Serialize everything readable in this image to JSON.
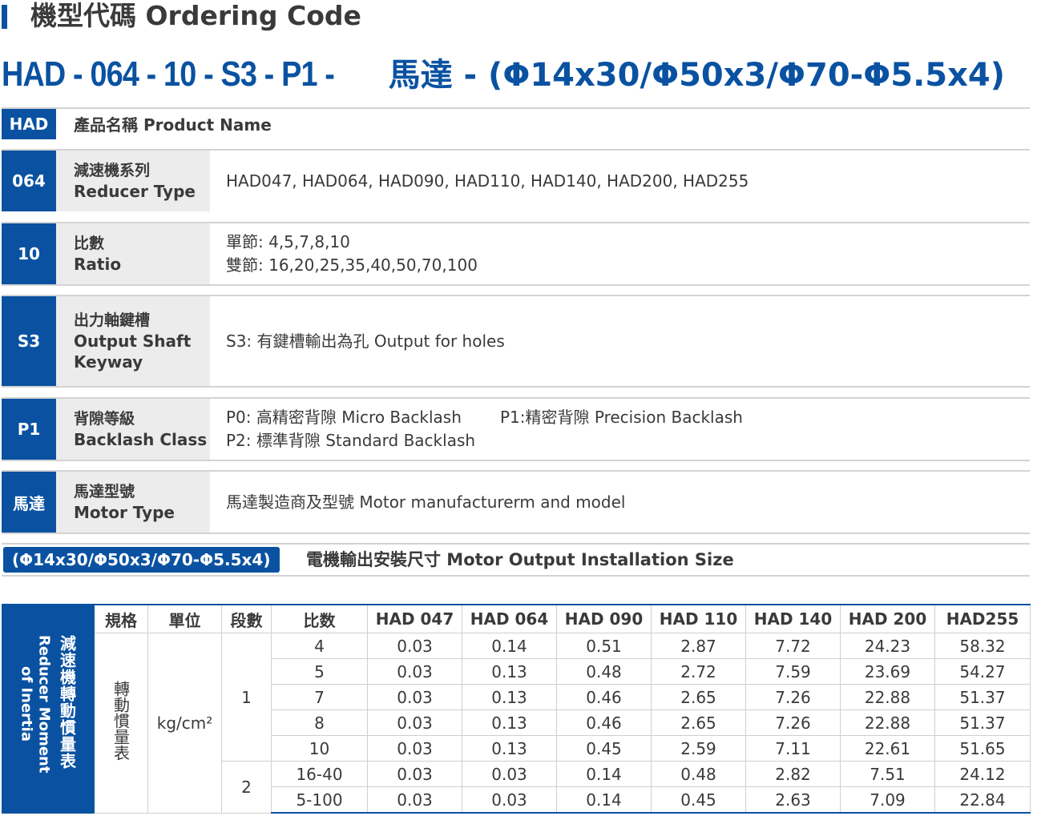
{
  "header": {
    "title": "機型代碼 Ordering Code"
  },
  "code": {
    "part1": "HAD - 064 - 10 - S3 - P1 - ",
    "part2": "馬達 - (Φ14x30/Φ50x3/Φ70-Φ5.5x4)"
  },
  "rows": {
    "had": {
      "tag": "HAD",
      "label": "產品名稱 Product Name"
    },
    "r064": {
      "tag": "064",
      "zh": "減速機系列",
      "en": "Reducer Type",
      "value": "HAD047, HAD064, HAD090, HAD110, HAD140, HAD200, HAD255"
    },
    "r10": {
      "tag": "10",
      "zh": "比數",
      "en": "Ratio",
      "value1": "單節: 4,5,7,8,10",
      "value2": "雙節: 16,20,25,35,40,50,70,100"
    },
    "s3": {
      "tag": "S3",
      "zh": "出力軸鍵槽",
      "en1": "Output Shaft",
      "en2": "Keyway",
      "value": "S3: 有鍵槽輸出為孔 Output for holes"
    },
    "p1": {
      "tag": "P1",
      "zh": "背隙等級",
      "en": "Backlash Class",
      "p0": "P0: 高精密背隙 Micro Backlash",
      "p1": "P1:精密背隙 Precision Backlash",
      "p2": "P2: 標準背隙 Standard Backlash"
    },
    "motor": {
      "tag": "馬達",
      "zh": "馬達型號",
      "en": "Motor Type",
      "value": "馬達製造商及型號 Motor manufacturerm and model"
    }
  },
  "install": {
    "tag": "(Φ14x30/Φ50x3/Φ70-Φ5.5x4)",
    "label": "電機輸出安裝尺寸 Motor Output Installation Size"
  },
  "inertia": {
    "side_zh": "減速機轉動慣量表",
    "side_en1": "Reducer Moment",
    "side_en2": "of Inertia",
    "headers": [
      "規格",
      "單位",
      "段數",
      "比数",
      "HAD 047",
      "HAD 064",
      "HAD 090",
      "HAD 110",
      "HAD 140",
      "HAD 200",
      "HAD255"
    ],
    "spec": "轉動慣量表",
    "unit": "kg/cm²",
    "stage1": "1",
    "stage2": "2",
    "rows": [
      [
        "4",
        "0.03",
        "0.14",
        "0.51",
        "2.87",
        "7.72",
        "24.23",
        "58.32"
      ],
      [
        "5",
        "0.03",
        "0.13",
        "0.48",
        "2.72",
        "7.59",
        "23.69",
        "54.27"
      ],
      [
        "7",
        "0.03",
        "0.13",
        "0.46",
        "2.65",
        "7.26",
        "22.88",
        "51.37"
      ],
      [
        "8",
        "0.03",
        "0.13",
        "0.46",
        "2.65",
        "7.26",
        "22.88",
        "51.37"
      ],
      [
        "10",
        "0.03",
        "0.13",
        "0.45",
        "2.59",
        "7.11",
        "22.61",
        "51.65"
      ],
      [
        "16-40",
        "0.03",
        "0.03",
        "0.14",
        "0.48",
        "2.82",
        "7.51",
        "24.12"
      ],
      [
        "5-100",
        "0.03",
        "0.03",
        "0.14",
        "0.45",
        "2.63",
        "7.09",
        "22.84"
      ]
    ]
  }
}
